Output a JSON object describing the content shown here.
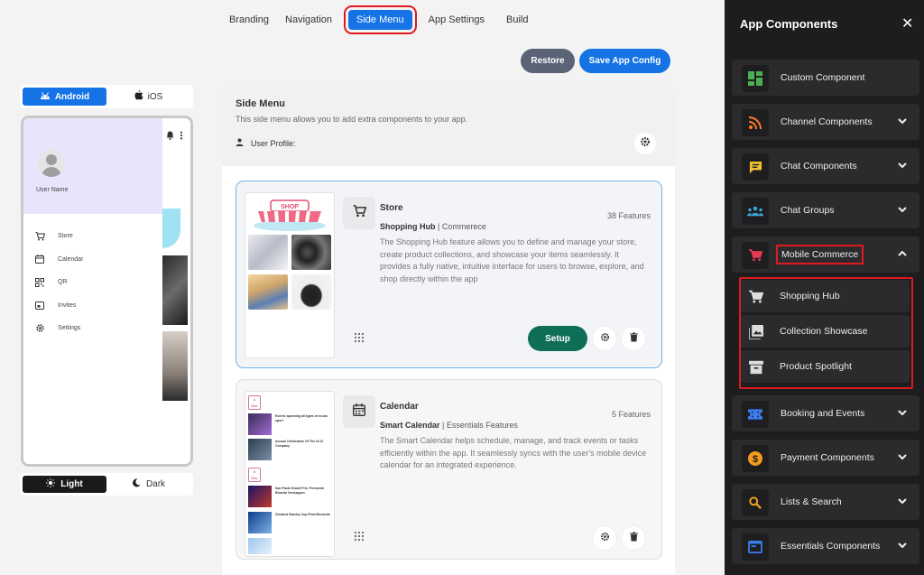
{
  "topnav": {
    "tabs": [
      {
        "label": "Branding"
      },
      {
        "label": "Navigation"
      },
      {
        "label": "Side Menu"
      },
      {
        "label": "App Settings"
      },
      {
        "label": "Build"
      }
    ]
  },
  "actions": {
    "restore": "Restore",
    "save": "Save App Config"
  },
  "preview": {
    "os": {
      "android": "Android",
      "ios": "iOS"
    },
    "user_name": "User Name",
    "menu": [
      "Store",
      "Calendar",
      "QR",
      "Invites",
      "Settings"
    ],
    "theme": {
      "light": "Light",
      "dark": "Dark"
    }
  },
  "panel": {
    "title": "Side Menu",
    "description": "This side menu allows you to add extra components to your app.",
    "user_profile": "User Profile:"
  },
  "cards": {
    "store": {
      "name": "Store",
      "sub_bold": "Shopping Hub",
      "sub_rest": " | Commerece",
      "features": "38 Features",
      "desc": "The Shopping Hub feature allows you to define and manage your store, create product collections, and showcase your items seamlessly. It provides a fully native, intuitive interface for users to browse, explore, and shop directly within the app",
      "setup": "Setup",
      "thumb_sign": "SHOP"
    },
    "calendar": {
      "name": "Calendar",
      "sub_bold": "Smart Calendar",
      "sub_rest": " | Essentials Features",
      "features": "5 Features",
      "desc": "The Smart Calendar helps schedule, manage, and track events or tasks efficiently within the app. It seamlessly syncs with the user's mobile device calendar for an integrated experience.",
      "thumb": {
        "date1_num": "4",
        "date1_mon": "Dec",
        "date2_num": "5",
        "date2_mon": "Dec",
        "e1": "Events spanning all types of music sport",
        "e2": "Annual Celebration Of The XLCI Company",
        "e3": "Sao Paulo Grand Prix: Fernando Ricardo Verstappen",
        "e4": "Greatest Stanley Cup Final Moments"
      }
    }
  },
  "sidebar": {
    "title": "App Components",
    "items": [
      {
        "label": "Custom Component",
        "icon": "grid-icon",
        "color": "#4caf50"
      },
      {
        "label": "Channel Components",
        "icon": "rss-icon",
        "color": "#ff7a29"
      },
      {
        "label": "Chat Components",
        "icon": "chat-icon",
        "color": "#f2c12e"
      },
      {
        "label": "Chat Groups",
        "icon": "groups-icon",
        "color": "#3aa3d8"
      },
      {
        "label": "Mobile Commerce",
        "icon": "cart-icon",
        "color": "#e53950"
      },
      {
        "label": "Booking and Events",
        "icon": "ticket-icon",
        "color": "#3b7cf0"
      },
      {
        "label": "Payment Components",
        "icon": "dollar-icon",
        "color": "#f29a1f"
      },
      {
        "label": "Lists & Search",
        "icon": "search-icon",
        "color": "#f2a31e"
      },
      {
        "label": "Essentials Components",
        "icon": "window-icon",
        "color": "#3b7cf0"
      }
    ],
    "subitems": [
      {
        "label": "Shopping Hub",
        "icon": "cart-icon"
      },
      {
        "label": "Collection Showcase",
        "icon": "gallery-icon"
      },
      {
        "label": "Product Spotlight",
        "icon": "archive-icon"
      }
    ]
  }
}
